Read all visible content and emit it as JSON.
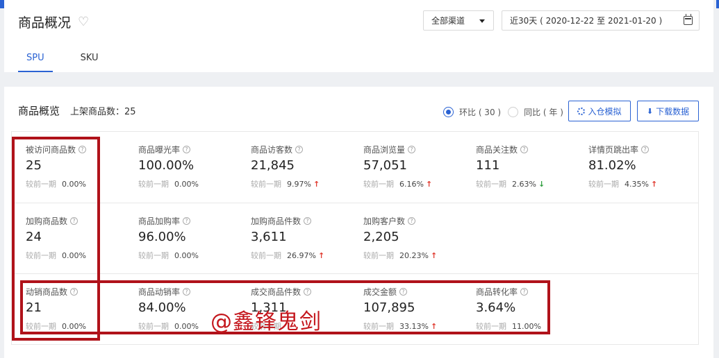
{
  "header": {
    "title": "商品概况",
    "channel": "全部渠道",
    "date_range": "近30天 ( 2020-12-22 至 2021-01-20 )",
    "tabs": [
      "SPU",
      "SKU"
    ]
  },
  "overview": {
    "title": "商品概览",
    "listed_count": "上架商品数：25",
    "radio": [
      {
        "label": "环比 ( 30 )",
        "checked": true
      },
      {
        "label": "同比 ( 年 )",
        "checked": false
      }
    ],
    "simulate_button": "入仓模拟",
    "download_button": "下载数据"
  },
  "compare_label": "较前一期",
  "metrics": {
    "row1": [
      {
        "label": "被访问商品数",
        "value": "25",
        "change": "0.00%",
        "trend": ""
      },
      {
        "label": "商品曝光率",
        "value": "100.00%",
        "change": "0.00%",
        "trend": ""
      },
      {
        "label": "商品访客数",
        "value": "21,845",
        "change": "9.97%",
        "trend": "↑"
      },
      {
        "label": "商品浏览量",
        "value": "57,051",
        "change": "6.16%",
        "trend": "↑"
      },
      {
        "label": "商品关注数",
        "value": "111",
        "change": "2.63%",
        "trend": "↓"
      },
      {
        "label": "详情页跳出率",
        "value": "81.02%",
        "change": "4.35%",
        "trend": "↑"
      }
    ],
    "row2": [
      {
        "label": "加购商品数",
        "value": "24",
        "change": "0.00%",
        "trend": ""
      },
      {
        "label": "商品加购率",
        "value": "96.00%",
        "change": "0.00%",
        "trend": ""
      },
      {
        "label": "加购商品件数",
        "value": "3,611",
        "change": "26.97%",
        "trend": "↑"
      },
      {
        "label": "加购客户数",
        "value": "2,205",
        "change": "20.23%",
        "trend": "↑"
      }
    ],
    "row3": [
      {
        "label": "动销商品数",
        "value": "21",
        "change": "0.00%",
        "trend": ""
      },
      {
        "label": "商品动销率",
        "value": "84.00%",
        "change": "0.00%",
        "trend": ""
      },
      {
        "label": "成交商品件数",
        "value": "1,311",
        "change": "",
        "trend": ""
      },
      {
        "label": "成交金额",
        "value": "107,895",
        "change": "33.13%",
        "trend": "↑"
      },
      {
        "label": "商品转化率",
        "value": "3.64%",
        "change": "11.00%",
        "trend": ""
      }
    ]
  },
  "watermark": "@鑫锋鬼剑",
  "colors": {
    "accent": "#2a62d3",
    "up": "#e03a2f",
    "down": "#2e9e3e",
    "annotation": "#b0121a"
  }
}
